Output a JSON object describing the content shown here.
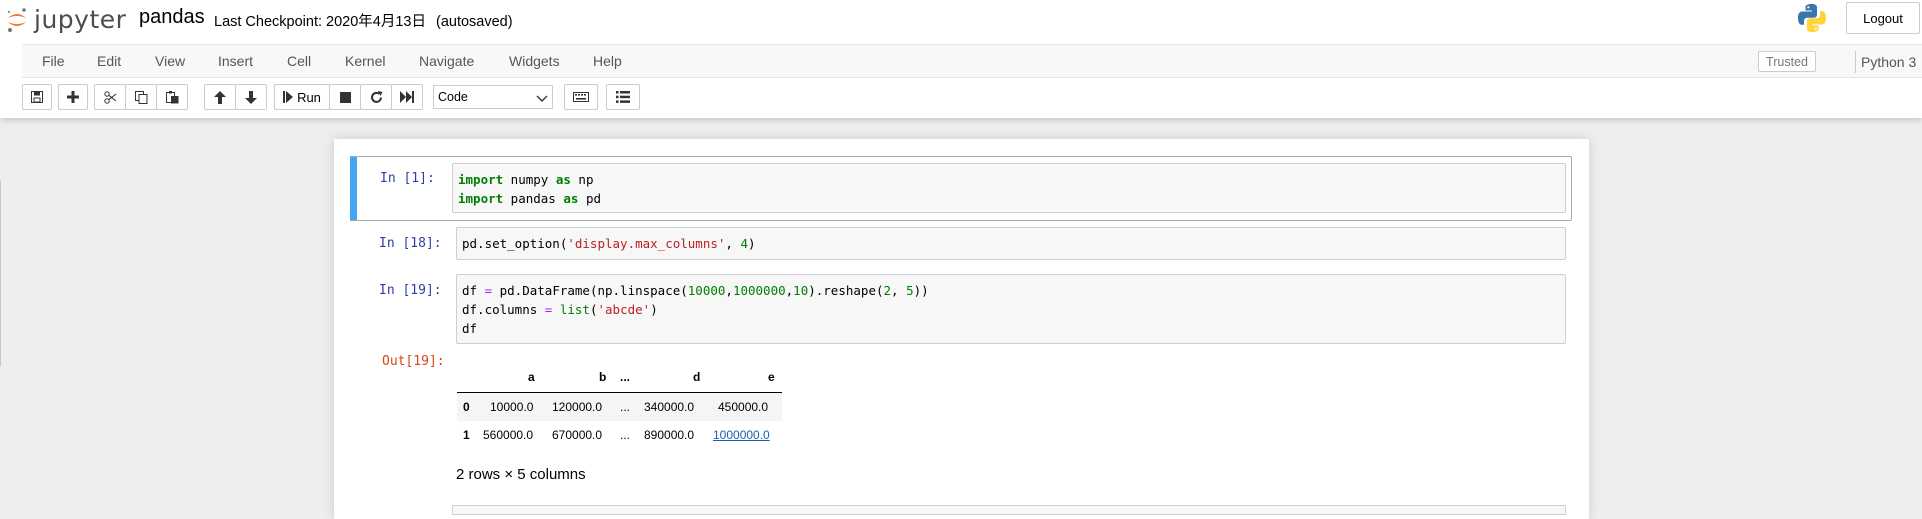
{
  "header": {
    "logo_text": "jupyter",
    "notebook_name": "pandas",
    "checkpoint_text": "Last Checkpoint: 2020年4月13日",
    "autosave_text": "(autosaved)",
    "logout_label": "Logout"
  },
  "menubar": {
    "items": [
      "File",
      "Edit",
      "View",
      "Insert",
      "Cell",
      "Kernel",
      "Navigate",
      "Widgets",
      "Help"
    ],
    "trusted_label": "Trusted",
    "kernel_name": "Python 3"
  },
  "toolbar": {
    "run_label": "Run",
    "cell_type": "Code"
  },
  "cells": [
    {
      "prompt": "In  [1]:",
      "lines": [
        "import numpy as np",
        "import pandas as pd"
      ]
    },
    {
      "prompt": "In  [18]:",
      "lines": [
        "pd.set_option('display.max_columns', 4)"
      ]
    },
    {
      "prompt": "In  [19]:",
      "lines": [
        "df = pd.DataFrame(np.linspace(10000,1000000,10).reshape(2, 5))",
        "df.columns = list('abcde')",
        "df"
      ]
    }
  ],
  "output": {
    "prompt": "Out[19]:",
    "columns": [
      "",
      "a",
      "b",
      "...",
      "d",
      "e"
    ],
    "rows": [
      [
        "0",
        "10000.0",
        "120000.0",
        "...",
        "340000.0",
        "450000.0"
      ],
      [
        "1",
        "560000.0",
        "670000.0",
        "...",
        "890000.0",
        "1000000.0"
      ]
    ],
    "shape_text": "2 rows × 5 columns"
  },
  "colors": {
    "selected_bar": "#42a5f5",
    "in_prompt": "#303f9f",
    "out_prompt": "#d84315",
    "keyword": "#008000",
    "string": "#ba2121"
  },
  "icons": [
    "jupyter-logo-icon",
    "python-logo-icon",
    "save-icon",
    "plus-icon",
    "cut-icon",
    "copy-icon",
    "paste-icon",
    "arrow-up-icon",
    "arrow-down-icon",
    "step-forward-icon",
    "stop-icon",
    "restart-icon",
    "fast-forward-icon",
    "keyboard-icon",
    "list-icon",
    "kernel-idle-icon"
  ]
}
